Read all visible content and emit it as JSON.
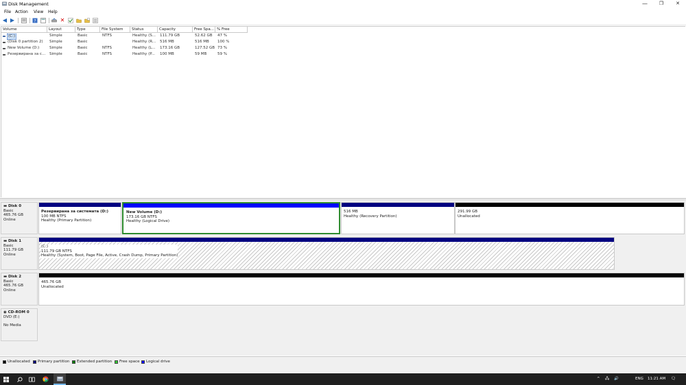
{
  "window": {
    "title": "Disk Management",
    "controls": {
      "minimize": "—",
      "maximize": "❐",
      "close": "✕"
    }
  },
  "menu": [
    "File",
    "Action",
    "View",
    "Help"
  ],
  "toolbar": {
    "icons": [
      "back-arrow-icon",
      "forward-arrow-icon",
      "properties-icon",
      "help-icon",
      "show-list-icon",
      "connect-icon",
      "delete-icon",
      "check-icon",
      "folder-open-icon",
      "folder-add-icon",
      "list-view-icon"
    ]
  },
  "volumes": {
    "columns": [
      "Volume",
      "Layout",
      "Type",
      "File System",
      "Status",
      "Capacity",
      "Free Spa...",
      "% Free"
    ],
    "rows": [
      {
        "volume": "(C:)",
        "layout": "Simple",
        "type": "Basic",
        "fs": "NTFS",
        "status": "Healthy (S...",
        "capacity": "111.79 GB",
        "free": "52.62 GB",
        "pct": "47 %"
      },
      {
        "volume": "(Disk 0 partition 2)",
        "layout": "Simple",
        "type": "Basic",
        "fs": "",
        "status": "Healthy (R...",
        "capacity": "516 MB",
        "free": "516 MB",
        "pct": "100 %"
      },
      {
        "volume": "New Volume (D:)",
        "layout": "Simple",
        "type": "Basic",
        "fs": "NTFS",
        "status": "Healthy (L...",
        "capacity": "173.16 GB",
        "free": "127.52 GB",
        "pct": "73 %"
      },
      {
        "volume": "Резервирана за с...",
        "layout": "Simple",
        "type": "Basic",
        "fs": "NTFS",
        "status": "Healthy (P...",
        "capacity": "100 MB",
        "free": "59 MB",
        "pct": "59 %"
      }
    ]
  },
  "disks": [
    {
      "name": "Disk 0",
      "kind": "Basic",
      "size": "465.76 GB",
      "state": "Online",
      "partitions": [
        {
          "title": "Резервирана за системата (D:)",
          "line2": "100 MB NTFS",
          "line3": "Healthy (Primary Partition)",
          "color": "#000080"
        },
        {
          "title": "New Volume (D:)",
          "line2": "173.16 GB NTFS",
          "line3": "Healthy (Logical Drive)",
          "color": "#0000ff"
        },
        {
          "title": "",
          "line2": "516 MB",
          "line3": "Healthy (Recovery Partition)",
          "color": "#000080"
        },
        {
          "title": "",
          "line2": "291.99 GB",
          "line3": "Unallocated",
          "color": "#000000"
        }
      ]
    },
    {
      "name": "Disk 1",
      "kind": "Basic",
      "size": "111.79 GB",
      "state": "Online",
      "partitions": [
        {
          "title": "(C:)",
          "line2": "111.79 GB NTFS",
          "line3": "Healthy (System, Boot, Page File, Active, Crash Dump, Primary Partition)",
          "color": "#000080"
        }
      ]
    },
    {
      "name": "Disk 2",
      "kind": "Basic",
      "size": "465.76 GB",
      "state": "Online",
      "partitions": [
        {
          "title": "",
          "line2": "465.76 GB",
          "line3": "Unallocated",
          "color": "#000000"
        }
      ]
    },
    {
      "name": "CD-ROM 0",
      "kind": "DVD (E:)",
      "size": "",
      "state": "No Media",
      "partitions": []
    }
  ],
  "legend": [
    {
      "label": "Unallocated",
      "color": "#000000"
    },
    {
      "label": "Primary partition",
      "color": "#000080"
    },
    {
      "label": "Extended partition",
      "color": "#008000"
    },
    {
      "label": "Free space",
      "color": "#33cc33"
    },
    {
      "label": "Logical drive",
      "color": "#0000ff"
    }
  ],
  "taskbar": {
    "icons": [
      "start-icon",
      "search-icon",
      "task-view-icon",
      "chrome-icon",
      "disk-management-icon"
    ],
    "tray": {
      "chevron": "^",
      "network": "🖧",
      "volume": "🔊",
      "language": "ENG",
      "time": "11:21 AM",
      "notifications": "🗨"
    }
  }
}
